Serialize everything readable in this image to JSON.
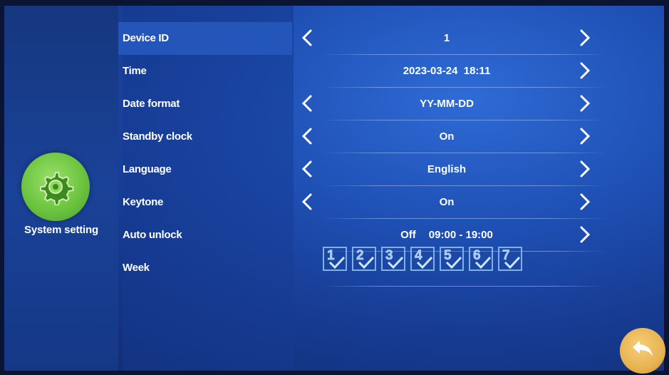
{
  "sidebar": {
    "title": "System setting",
    "icon": "gear-icon"
  },
  "settings": {
    "rows": [
      {
        "label": "Device ID",
        "value": "1"
      },
      {
        "label": "Time",
        "value": "2023-03-24  18:11"
      },
      {
        "label": "Date format",
        "value": "YY-MM-DD"
      },
      {
        "label": "Standby clock",
        "value": "On"
      },
      {
        "label": "Language",
        "value": "English"
      },
      {
        "label": "Keytone",
        "value": "On"
      },
      {
        "label": "Auto unlock",
        "value_status": "Off",
        "value_time": "09:00 - 19:00"
      },
      {
        "label": "Week"
      }
    ],
    "week_days": [
      "1",
      "2",
      "3",
      "4",
      "5",
      "6",
      "7"
    ]
  },
  "colors": {
    "accent_green": "#6cc43f",
    "back_button": "#e8b352",
    "selected_row": "#2455b8"
  },
  "icons": {
    "prev": "chevron-left-icon",
    "next": "chevron-right-icon",
    "checked": "checkmark-icon",
    "back": "back-arrow-icon"
  }
}
